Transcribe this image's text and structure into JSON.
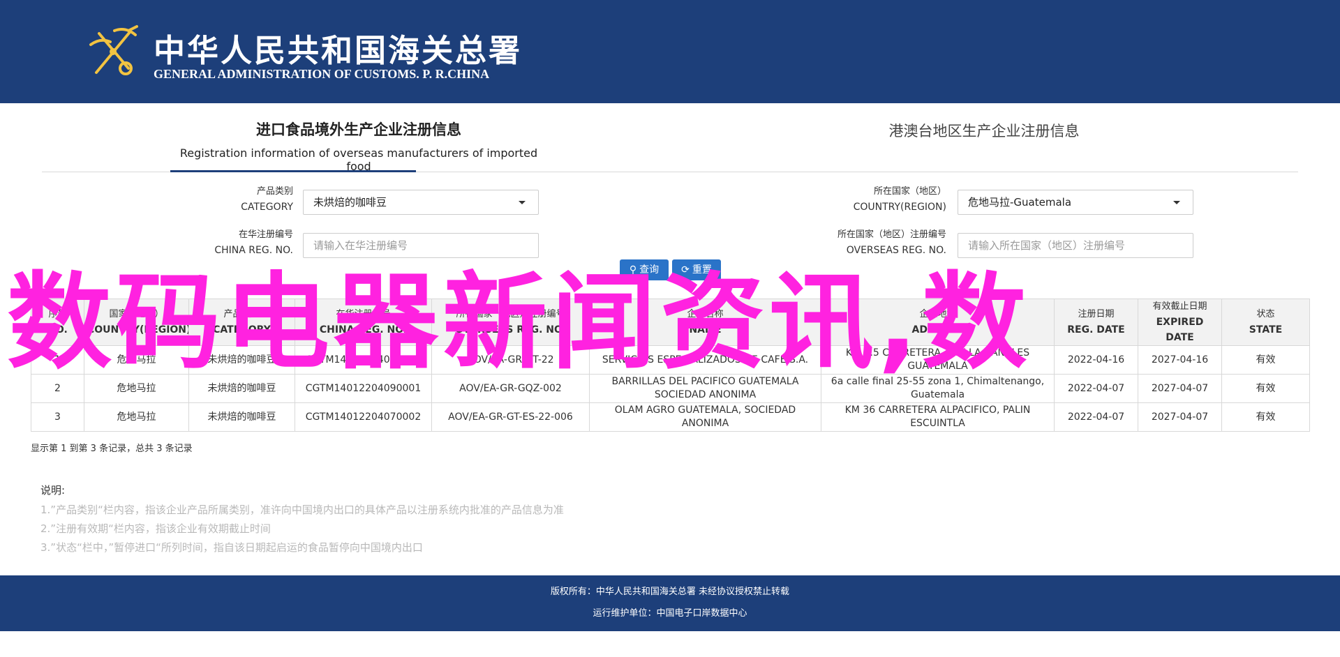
{
  "header": {
    "title_cn": "中华人民共和国海关总署",
    "title_en": "GENERAL ADMINISTRATION OF CUSTOMS. P. R.CHINA"
  },
  "tabs": [
    {
      "label_cn": "进口食品境外生产企业注册信息",
      "label_en": "Registration information of overseas manufacturers of imported food",
      "active": true
    },
    {
      "label_cn": "港澳台地区生产企业注册信息",
      "active": false
    }
  ],
  "form": {
    "category": {
      "label_cn": "产品类别",
      "label_en": "CATEGORY",
      "value": "未烘焙的咖啡豆"
    },
    "country": {
      "label_cn": "所在国家（地区）",
      "label_en": "COUNTRY(REGION)",
      "value": "危地马拉-Guatemala"
    },
    "china_reg": {
      "label_cn": "在华注册编号",
      "label_en": "CHINA REG. NO.",
      "placeholder": "请输入在华注册编号"
    },
    "overseas_reg": {
      "label_cn": "所在国家（地区）注册编号",
      "label_en": "OVERSEAS REG. NO.",
      "placeholder": "请输入所在国家（地区）注册编号"
    },
    "search_label": "查询",
    "reset_label": "重置"
  },
  "table": {
    "columns": [
      {
        "cn": "序号",
        "en": "NO."
      },
      {
        "cn": "国家（地区）",
        "en": "COUNTRY(REGION)"
      },
      {
        "cn": "产品类别",
        "en": "CATEGORY"
      },
      {
        "cn": "在华注册编号",
        "en": "CHINA REG. NO."
      },
      {
        "cn": "所在国家（地区）注册编号",
        "en": "OVERSEAS REG. NO."
      },
      {
        "cn": "企业名称",
        "en": "NAME"
      },
      {
        "cn": "企业地址",
        "en": "ADDRESS"
      },
      {
        "cn": "注册日期",
        "en": "REG. DATE"
      },
      {
        "cn": "有效截止日期",
        "en": "EXPIRED DATE"
      },
      {
        "cn": "状态",
        "en": "STATE"
      }
    ],
    "rows": [
      [
        "1",
        "危地马拉",
        "未烘焙的咖啡豆",
        "CGTM14012204090003",
        "AOV/EA-GR-GT-22",
        "SERVICIOS ESPECIALIZADOS DE CAFE S.A.",
        "KM 5.5 CARRETERA A VILLA CANALES GUATEMALA",
        "2022-04-16",
        "2027-04-16",
        "有效"
      ],
      [
        "2",
        "危地马拉",
        "未烘焙的咖啡豆",
        "CGTM14012204090001",
        "AOV/EA-GR-GQZ-002",
        "BARRILLAS DEL PACIFICO GUATEMALA SOCIEDAD ANONIMA",
        "6a calle final 25-55 zona 1, Chimaltenango, Guatemala",
        "2022-04-07",
        "2027-04-07",
        "有效"
      ],
      [
        "3",
        "危地马拉",
        "未烘焙的咖啡豆",
        "CGTM14012204070002",
        "AOV/EA-GR-GT-ES-22-006",
        "OLAM AGRO GUATEMALA, SOCIEDAD ANONIMA",
        "KM 36 CARRETERA ALPACIFICO, PALIN ESCUINTLA",
        "2022-04-07",
        "2027-04-07",
        "有效"
      ]
    ]
  },
  "summary": "显示第 1 到第 3 条记录，总共 3 条记录",
  "notes": {
    "title": "说明:",
    "items": [
      "1.”产品类别“栏内容，指该企业产品所属类别，准许向中国境内出口的具体产品以注册系统内批准的产品信息为准",
      "2.”注册有效期“栏内容，指该企业有效期截止时间",
      "3.”状态“栏中，”暂停进口“所列时间，指自该日期起启运的食品暂停向中国境内出口"
    ]
  },
  "footer": {
    "line1": "版权所有：中华人民共和国海关总署 未经协议授权禁止转载",
    "line2": "运行维护单位：中国电子口岸数据中心"
  },
  "overlay_text": "数码电器新闻资讯,数",
  "colors": {
    "brand_blue": "#1d3f7a",
    "button_blue": "#2a73c8",
    "overlay_magenta": "#ff22e0"
  }
}
